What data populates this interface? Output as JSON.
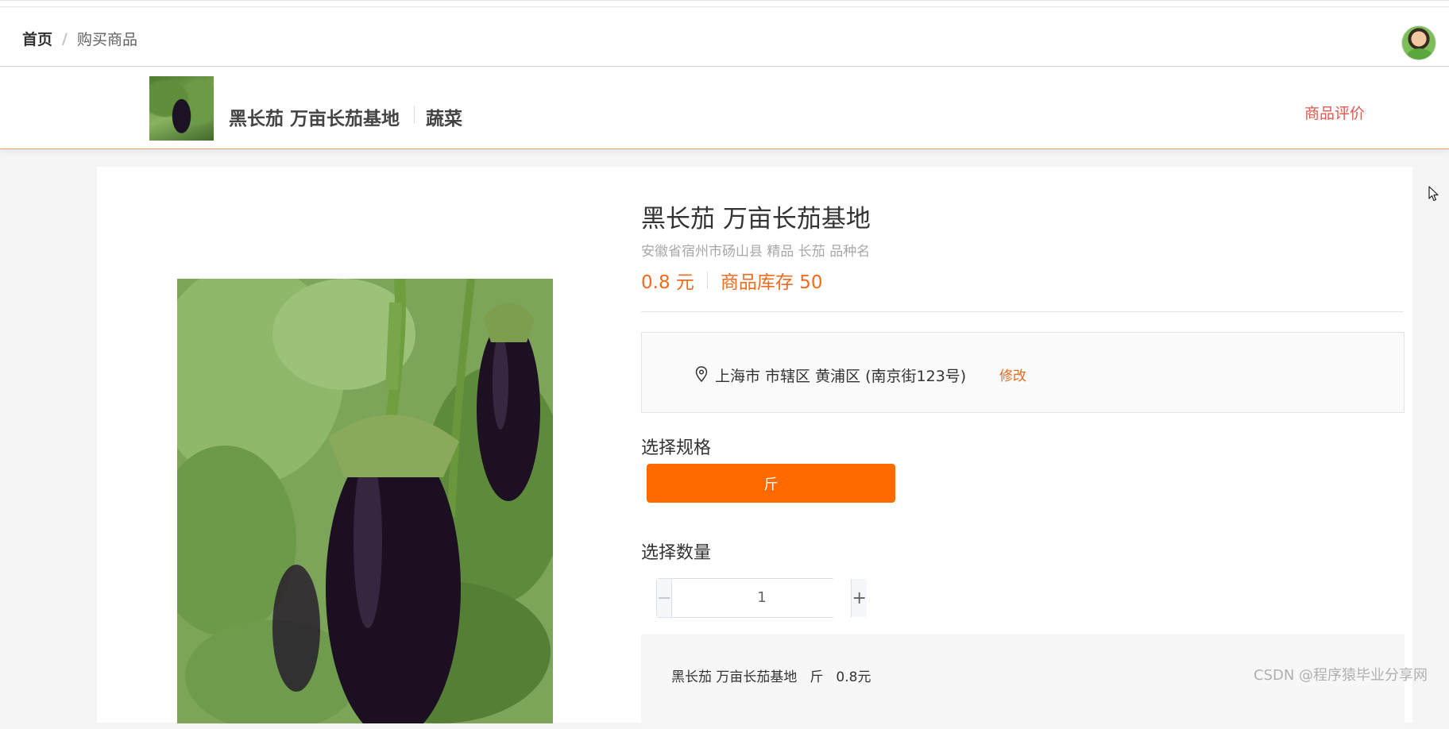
{
  "breadcrumb": {
    "home": "首页",
    "separator": "/",
    "current": "购买商品"
  },
  "header": {
    "product_name": "黑长茄 万亩长茄基地",
    "category": "蔬菜",
    "review_link": "商品评价"
  },
  "product": {
    "title": "黑长茄 万亩长茄基地",
    "subtitle": "安徽省宿州市砀山县 精品 长茄 品种名",
    "price": "0.8 元",
    "stock": "商品库存 50"
  },
  "address": {
    "text": "上海市 市辖区 黄浦区 (南京街123号)",
    "edit_label": "修改"
  },
  "spec": {
    "label": "选择规格",
    "option": "斤"
  },
  "quantity": {
    "label": "选择数量",
    "minus": "−",
    "value": "1",
    "plus": "+"
  },
  "summary": {
    "name": "黑长茄 万亩长茄基地",
    "unit": "斤",
    "price": "0.8元"
  },
  "watermark": "CSDN @程序猿毕业分享网",
  "colors": {
    "accent": "#ff6a00",
    "price": "#f26b1d",
    "review": "#e2584d"
  }
}
